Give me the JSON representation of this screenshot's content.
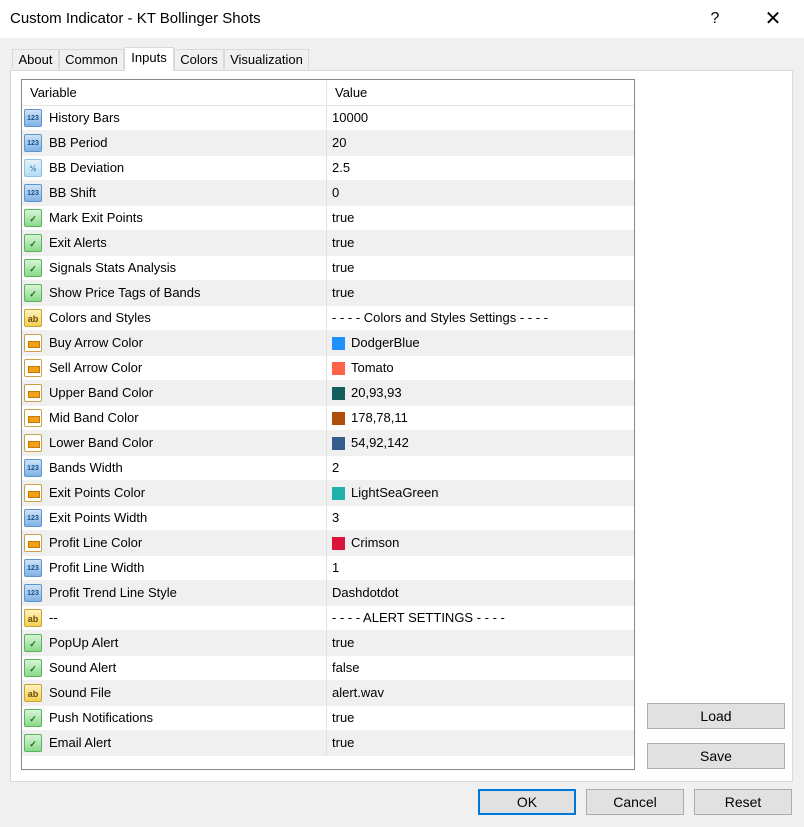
{
  "window": {
    "title": "Custom Indicator - KT Bollinger Shots",
    "help": "?",
    "close": "✕"
  },
  "tabs": [
    "About",
    "Common",
    "Inputs",
    "Colors",
    "Visualization"
  ],
  "active_tab": "Inputs",
  "grid": {
    "headers": {
      "variable": "Variable",
      "value": "Value"
    },
    "rows": [
      {
        "type": "int",
        "icon": "123",
        "variable": "History Bars",
        "value": "10000"
      },
      {
        "type": "int",
        "icon": "123",
        "variable": "BB Period",
        "value": "20"
      },
      {
        "type": "dbl",
        "icon": "½",
        "variable": "BB Deviation",
        "value": "2.5"
      },
      {
        "type": "int",
        "icon": "123",
        "variable": "BB Shift",
        "value": "0"
      },
      {
        "type": "bool",
        "icon": "✓",
        "variable": "Mark Exit Points",
        "value": "true"
      },
      {
        "type": "bool",
        "icon": "✓",
        "variable": "Exit Alerts",
        "value": "true"
      },
      {
        "type": "bool",
        "icon": "✓",
        "variable": "Signals Stats Analysis",
        "value": "true"
      },
      {
        "type": "bool",
        "icon": "✓",
        "variable": "Show Price Tags of Bands",
        "value": "true"
      },
      {
        "type": "str",
        "icon": "ab",
        "variable": "Colors and Styles",
        "value": "- - - - Colors and Styles Settings - - - -"
      },
      {
        "type": "clr",
        "icon": "",
        "variable": "Buy Arrow Color",
        "value": "DodgerBlue",
        "swatch": "#1e90ff"
      },
      {
        "type": "clr",
        "icon": "",
        "variable": "Sell Arrow Color",
        "value": "Tomato",
        "swatch": "#ff6347"
      },
      {
        "type": "clr",
        "icon": "",
        "variable": "Upper Band Color",
        "value": "20,93,93",
        "swatch": "#145d5d"
      },
      {
        "type": "clr",
        "icon": "",
        "variable": "Mid Band Color",
        "value": "178,78,11",
        "swatch": "#b24e0b"
      },
      {
        "type": "clr",
        "icon": "",
        "variable": "Lower Band Color",
        "value": "54,92,142",
        "swatch": "#365c8e"
      },
      {
        "type": "int",
        "icon": "123",
        "variable": "Bands Width",
        "value": "2"
      },
      {
        "type": "clr",
        "icon": "",
        "variable": "Exit Points Color",
        "value": "LightSeaGreen",
        "swatch": "#20b2aa"
      },
      {
        "type": "int",
        "icon": "123",
        "variable": "Exit Points Width",
        "value": "3"
      },
      {
        "type": "clr",
        "icon": "",
        "variable": "Profit Line Color",
        "value": "Crimson",
        "swatch": "#dc143c"
      },
      {
        "type": "int",
        "icon": "123",
        "variable": "Profit Line Width",
        "value": "1"
      },
      {
        "type": "int",
        "icon": "123",
        "variable": "Profit Trend Line Style",
        "value": "Dashdotdot"
      },
      {
        "type": "str",
        "icon": "ab",
        "variable": "--",
        "value": "- - - - ALERT SETTINGS - - - -"
      },
      {
        "type": "bool",
        "icon": "✓",
        "variable": "PopUp Alert",
        "value": "true"
      },
      {
        "type": "bool",
        "icon": "✓",
        "variable": "Sound Alert",
        "value": "false"
      },
      {
        "type": "str",
        "icon": "ab",
        "variable": "Sound File",
        "value": "alert.wav"
      },
      {
        "type": "bool",
        "icon": "✓",
        "variable": "Push Notifications",
        "value": "true"
      },
      {
        "type": "bool",
        "icon": "✓",
        "variable": "Email Alert",
        "value": "true"
      }
    ]
  },
  "side_buttons": {
    "load": "Load",
    "save": "Save"
  },
  "footer_buttons": {
    "ok": "OK",
    "cancel": "Cancel",
    "reset": "Reset"
  }
}
